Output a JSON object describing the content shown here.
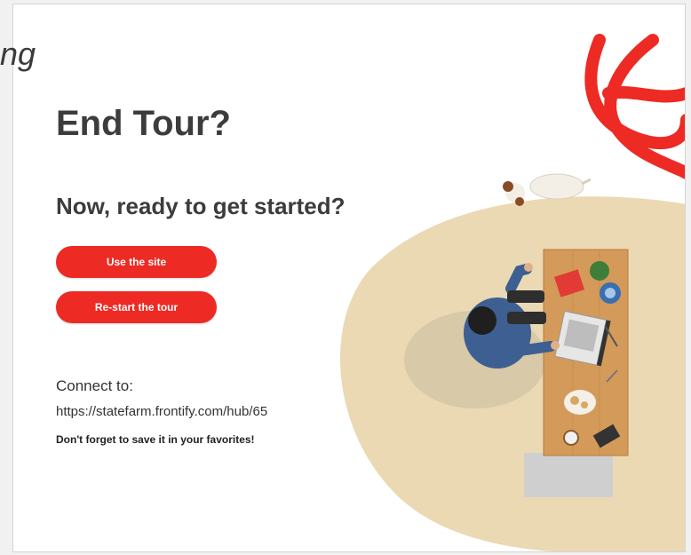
{
  "window": {
    "cut_title": "ng"
  },
  "main": {
    "title": "End Tour?",
    "subtitle": "Now, ready to get started?",
    "use_site_label": "Use the site",
    "restart_label": "Re-start the tour",
    "connect_label": "Connect to:",
    "url": "https://statefarm.frontify.com/hub/65",
    "favorites_note": "Don't forget to save it in your favorites!"
  },
  "colors": {
    "brand_red": "#ee2a24",
    "beige": "#ebd9b4",
    "text_dark": "#3c3c3c"
  },
  "icons": {
    "logo": "state-farm-ribbon-icon",
    "dog": "dog-icon",
    "person": "person-at-desk-icon"
  }
}
